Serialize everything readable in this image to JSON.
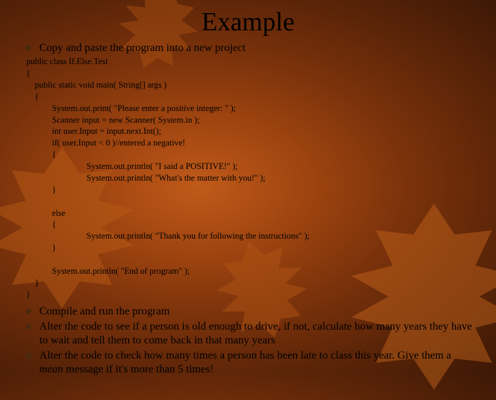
{
  "title": "Example",
  "bullets": {
    "b1": "Copy and paste the program into a new project",
    "b2": "Compile and run the program",
    "b3": "Alter the code to see if a person is old enough to drive, if not, calculate how many years they have to wait and tell them to come back in that many years",
    "b4_pre": "Alter the code to check how many times a person has been late to class this year. Give them a ",
    "b4_em": "mean",
    "b4_post": " message if it's more than 5 times!"
  },
  "code": "public class If.Else.Test\n{\n    public static void main( String[] args )\n    {\n            System.out.print( \"Please enter a positive integer: \" );\n            Scanner input = new Scanner( System.in );\n            int user.Input = input.next.Int();\n            if( user.Input < 0 )//entered a negative!\n            {\n                            System.out.println( \"I said a POSITIVE!\" );\n                            System.out.println( \"What's the matter with you!\" );\n            }\n\n            else\n            {\n                            System.out.println( \"Thank you for following the instructions\" );\n            }\n\n            System.out.println( \"End of program\" );\n    }\n}"
}
